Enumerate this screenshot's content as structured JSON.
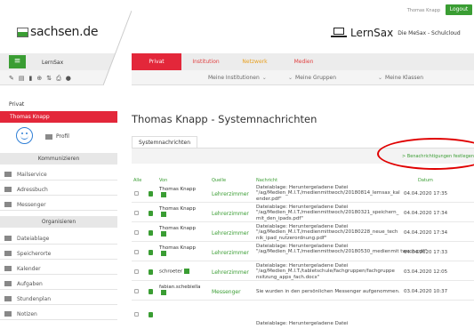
{
  "topbar": {
    "user": "Thomas Knapp",
    "logout_label": "Logout"
  },
  "brand": {
    "logo": "sachsen.de",
    "product": "LernSax",
    "product_sub": "Die MeSax - Schulcloud"
  },
  "nav": {
    "menu_label": "LernSax",
    "tabs": [
      {
        "label": "Privat",
        "active": true
      },
      {
        "label": "Institution"
      },
      {
        "label": "Netzwerk"
      },
      {
        "label": "Medien"
      }
    ],
    "filters": [
      "Meine Institutionen",
      "Meine Gruppen",
      "Meine Klassen"
    ],
    "tool_icons": [
      "settings-icon",
      "document-icon",
      "bookmark-icon",
      "add-icon",
      "sort-icon",
      "print-icon",
      "help-icon"
    ]
  },
  "sidebar": {
    "section": "Privat",
    "user": "Thomas Knapp",
    "profil": "Profil",
    "groups": [
      {
        "heading": "Kommunizieren",
        "items": [
          "Mailservice",
          "Adressbuch",
          "Messenger"
        ]
      },
      {
        "heading": "Organisieren",
        "items": [
          "Dateiablage",
          "Speicherorte",
          "Kalender",
          "Aufgaben",
          "Stundenplan",
          "Notizen"
        ]
      }
    ]
  },
  "main": {
    "title": "Thomas Knapp - Systemnachrichten",
    "tab": "Systemnachrichten",
    "notif_link": "> Benachrichtigungen festlegen",
    "columns": {
      "all": "Alle",
      "from": "Von",
      "source": "Quelle",
      "message": "Nachricht",
      "date": "Datum"
    },
    "rows": [
      {
        "from": "Thomas Knapp",
        "source": "Lehrerzimmer",
        "message": "Dateiablage: Heruntergeladene Datei \"/ag/Medien_M.I.T./medienmittwoch/20180814_lernsax_kal ender.pdf\"",
        "date": "04.04.2020 17:35"
      },
      {
        "from": "Thomas Knapp",
        "source": "Lehrerzimmer",
        "message": "Dateiablage: Heruntergeladene Datei \"/ag/Medien_M.I.T./medienmittwoch/20180321_speichern_ mit_den_ipads.pdf\"",
        "date": "04.04.2020 17:34"
      },
      {
        "from": "Thomas Knapp",
        "source": "Lehrerzimmer",
        "message": "Dateiablage: Heruntergeladene Datei \"/ag/Medien_M.I.T./medienmittwoch/20180228_neue_tech nik_ipad_nutzerordnung.pdf\"",
        "date": "04.04.2020 17:34"
      },
      {
        "from": "Thomas Knapp",
        "source": "Lehrerzimmer",
        "message": "Dateiablage: Heruntergeladene Datei \"/ag/Medien_M.I.T./medienmittwoch/20180530_medienmit twoch.pdf\"",
        "date": "04.04.2020 17:33"
      },
      {
        "from": "schroeter",
        "source": "Lehrerzimmer",
        "message": "Dateiablage: Heruntergeladene Datei \"/ag/Medien_M.I.T./tabletschule/fachgruppen/fachgruppe nsitzung_apps_fach.docx\"",
        "date": "03.04.2020 12:05"
      },
      {
        "from": "fabian.schebiella",
        "source": "Messenger",
        "message": "Sie wurden in den persönlichen Messenger aufgenommen.",
        "date": "03.04.2020 10:37"
      },
      {
        "from": "",
        "source": "",
        "message": "Dateiablage: Heruntergeladene Datei",
        "date": ""
      }
    ]
  },
  "colors": {
    "accent_green": "#3a9d33",
    "accent_red": "#e3273a",
    "highlight": "#e00000"
  }
}
